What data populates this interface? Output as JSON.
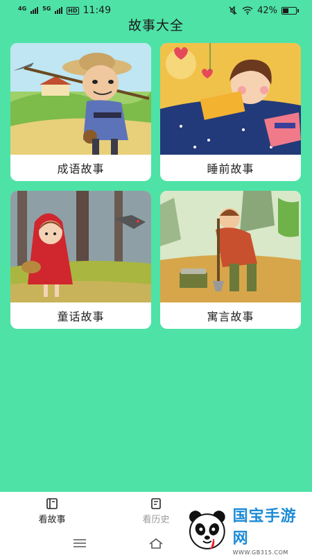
{
  "status_bar": {
    "signal1": "4G",
    "signal2": "5G",
    "hd": "HD",
    "time": "11:49",
    "battery": "42%",
    "battery_level": 0.42
  },
  "title": "故事大全",
  "cards": [
    {
      "label": "成语故事",
      "image": "farmer-with-hoe-illustration"
    },
    {
      "label": "睡前故事",
      "image": "sleeping-girl-illustration"
    },
    {
      "label": "童话故事",
      "image": "little-red-riding-hood-illustration"
    },
    {
      "label": "寓言故事",
      "image": "man-digging-treasure-illustration"
    }
  ],
  "tabs": [
    {
      "label": "看故事",
      "icon": "book-icon",
      "active": true
    },
    {
      "label": "看历史",
      "icon": "history-icon",
      "active": false
    }
  ],
  "nav": [
    "menu-icon",
    "home-icon"
  ],
  "watermark": {
    "name": "国宝手游网",
    "url": "WWW.GB315.COM"
  },
  "colors": {
    "background": "#4ee2a6",
    "card": "#ffffff",
    "text": "#222222",
    "watermark_blue": "#1c8bd6"
  }
}
